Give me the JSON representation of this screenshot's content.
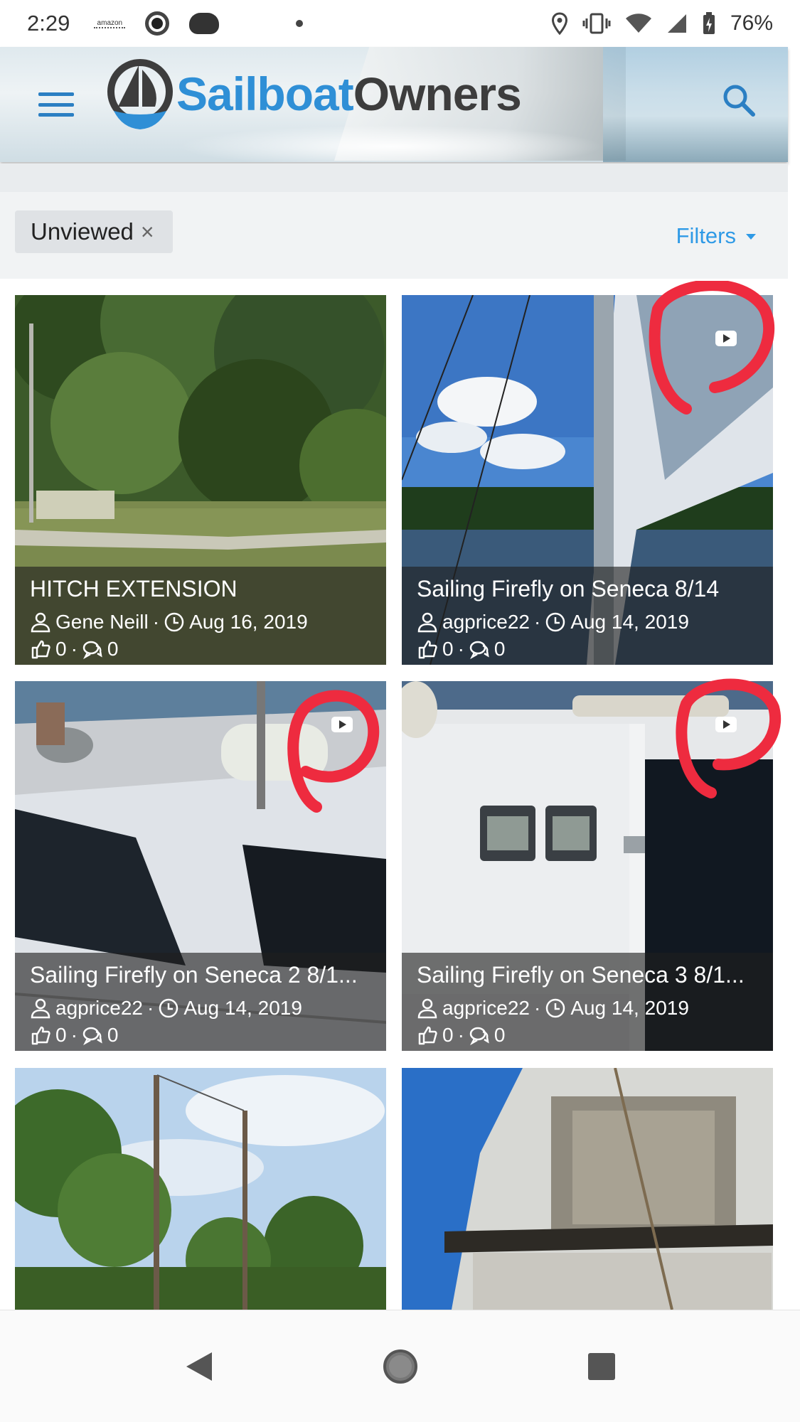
{
  "status_bar": {
    "time": "2:29",
    "amazon_label": "amazon",
    "battery": "76%"
  },
  "header": {
    "logo_part1": "Sailboat",
    "logo_part2": "Owners",
    "brand_color": "#2f8fd6"
  },
  "filters": {
    "active_chip": "Unviewed",
    "chip_remove": "×",
    "filters_label": "Filters"
  },
  "cards": [
    {
      "title": "HITCH EXTENSION",
      "author": "Gene Neill",
      "date": "Aug 16, 2019",
      "likes": "0",
      "comments": "0",
      "has_video": false
    },
    {
      "title": "Sailing Firefly on Seneca 8/14",
      "author": "agprice22",
      "date": "Aug 14, 2019",
      "likes": "0",
      "comments": "0",
      "has_video": true
    },
    {
      "title": "Sailing Firefly on Seneca 2 8/1...",
      "author": "agprice22",
      "date": "Aug 14, 2019",
      "likes": "0",
      "comments": "0",
      "has_video": true
    },
    {
      "title": "Sailing Firefly on Seneca 3 8/1...",
      "author": "agprice22",
      "date": "Aug 14, 2019",
      "likes": "0",
      "comments": "0",
      "has_video": true
    },
    {
      "title": "",
      "author": "",
      "date": "",
      "likes": "",
      "comments": "",
      "has_video": false
    },
    {
      "title": "",
      "author": "",
      "date": "",
      "likes": "",
      "comments": "",
      "has_video": false
    }
  ],
  "annotation_color": "#ee2b3f",
  "nav": {
    "back": "back-icon",
    "home": "home-icon",
    "recents": "recents-icon"
  }
}
